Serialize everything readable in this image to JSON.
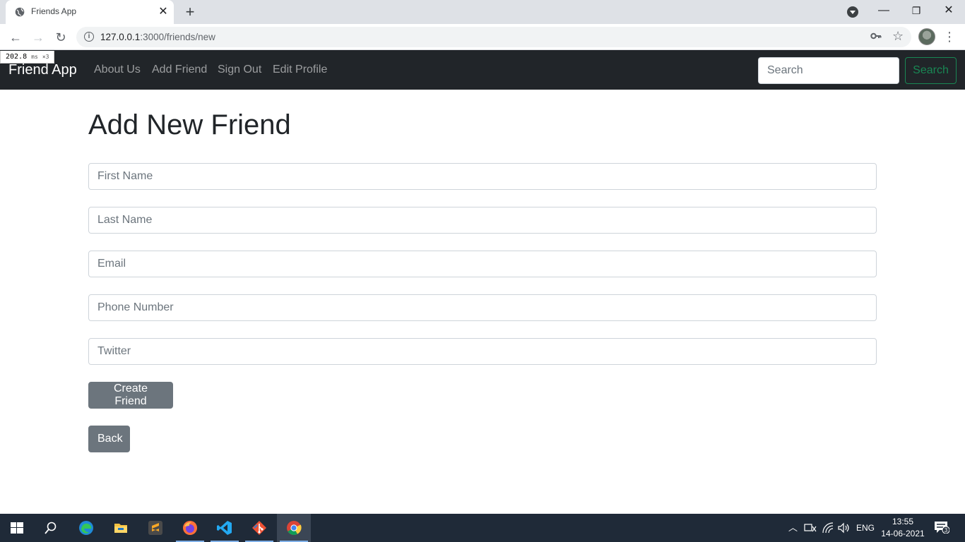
{
  "browser": {
    "tab_title": "Friends App",
    "tab_close": "✕",
    "new_tab": "+",
    "url_host": "127.0.0.1",
    "url_rest": ":3000/friends/new",
    "back": "←",
    "forward": "→",
    "reload": "↻",
    "star": "☆",
    "menu": "⋮",
    "minimize": "—",
    "maximize": "❐",
    "close": "✕",
    "perf_value": "202.8",
    "perf_unit": "ms",
    "perf_mult": "×3"
  },
  "navbar": {
    "brand": "Friend App",
    "links": [
      "About Us",
      "Add Friend",
      "Sign Out",
      "Edit Profile"
    ],
    "search_placeholder": "Search",
    "search_button": "Search"
  },
  "form": {
    "title": "Add New Friend",
    "fields": [
      {
        "placeholder": "First Name"
      },
      {
        "placeholder": "Last Name"
      },
      {
        "placeholder": "Email"
      },
      {
        "placeholder": "Phone Number"
      },
      {
        "placeholder": "Twitter"
      }
    ],
    "submit_label": "Create Friend",
    "back_label": "Back"
  },
  "taskbar": {
    "apps": [
      "start-icon",
      "search-icon",
      "edge-icon",
      "file-explorer-icon",
      "sublime-text-icon",
      "firefox-icon",
      "vscode-icon",
      "git-icon",
      "chrome-icon"
    ],
    "language": "ENG",
    "time": "13:55",
    "date": "14-06-2021",
    "notification_count": "3"
  },
  "colors": {
    "navbar_bg": "#212529",
    "success": "#198754",
    "secondary": "#6c757d"
  }
}
